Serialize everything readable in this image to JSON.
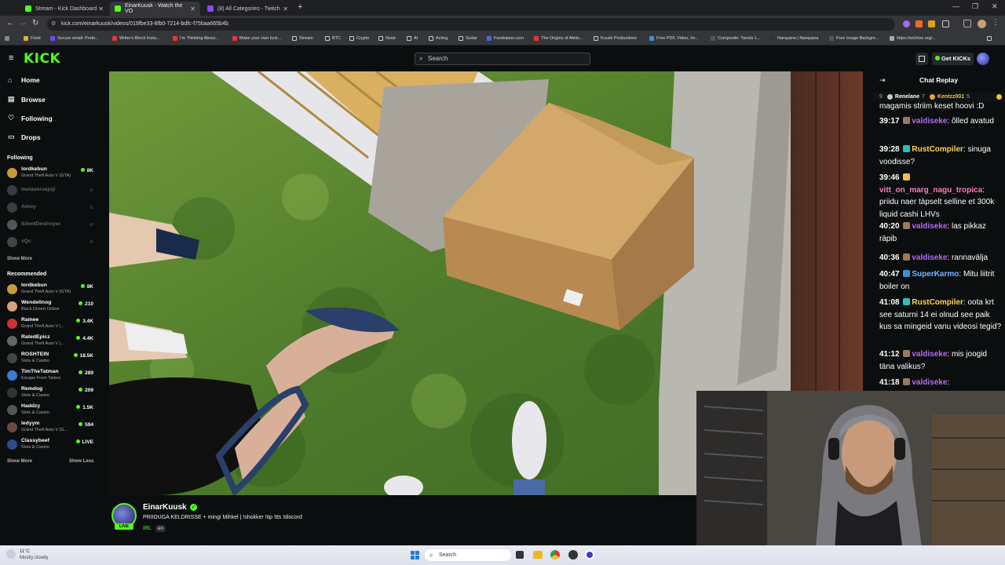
{
  "browser": {
    "tabs": [
      {
        "label": "Stream - Kick Dashboard",
        "color": "#53fc18",
        "active": false
      },
      {
        "label": "EinarKuusk - Watch the VO",
        "color": "#53fc18",
        "active": true
      },
      {
        "label": "(8) All Categories - Twitch",
        "color": "#9146ff",
        "active": false
      }
    ],
    "url": "kick.com/einarkuusk/videos/019fbe33-8fb0-7214-bdfc-f75baa665b4b",
    "bookmarks": [
      "Food",
      "Secure email: Proto...",
      "Writer's Block Insta...",
      "I'm Thinking About...",
      "Make your own luck...",
      "Stream",
      "BTC",
      "Crypto",
      "Nostr",
      "AI",
      "Acting",
      "Guitar",
      "Fundraiser.com",
      "The Origins of Akkis...",
      "Kuusk Productions",
      "Free PDF, Video, Im...",
      "Composite: Tavola 1...",
      "Narayana | Narayana",
      "Free Image Backgro...",
      "https://archive.org/..."
    ]
  },
  "header": {
    "logo": "KICK",
    "search_placeholder": "Search",
    "get_kicks": "Get KICKs"
  },
  "nav": {
    "home": "Home",
    "browse": "Browse",
    "following": "Following",
    "drops": "Drops"
  },
  "following": {
    "title": "Following",
    "channels": [
      {
        "name": "lordkebun",
        "game": "Grand Theft Auto V (GTA)",
        "viewers": "8K",
        "live": true,
        "color": "#c89a3a"
      },
      {
        "name": "metaversejoji",
        "live": false,
        "color": "#7a6a8a"
      },
      {
        "name": "Amoy",
        "live": false,
        "color": "#777"
      },
      {
        "name": "SilentDestroyer",
        "live": false,
        "color": "#aaa"
      },
      {
        "name": "xQc",
        "live": false,
        "color": "#888"
      }
    ],
    "show_more": "Show More"
  },
  "recommended": {
    "title": "Recommended",
    "channels": [
      {
        "name": "lordkebun",
        "game": "Grand Theft Auto V (GTA)",
        "viewers": "8K",
        "color": "#c89a3a"
      },
      {
        "name": "Wendellnog",
        "game": "Black Desert Online",
        "viewers": "210",
        "color": "#d4a27a"
      },
      {
        "name": "Ramee",
        "game": "Grand Theft Auto V (...",
        "viewers": "3.4K",
        "color": "#c33"
      },
      {
        "name": "RatedEpicz",
        "game": "Grand Theft Auto V (...",
        "viewers": "4.4K",
        "color": "#666"
      },
      {
        "name": "ROSHTEIN",
        "game": "Slots & Casino",
        "viewers": "18.5K",
        "color": "#444"
      },
      {
        "name": "TimTheTatman",
        "game": "Escape From Tarkov",
        "viewers": "289",
        "color": "#3a7bd5"
      },
      {
        "name": "Remdog",
        "game": "Slots & Casino",
        "viewers": "209",
        "color": "#333"
      },
      {
        "name": "Haddzy",
        "game": "Slots & Casino",
        "viewers": "1.5K",
        "color": "#555"
      },
      {
        "name": "ledyym",
        "game": "Grand Theft Auto V (G...",
        "viewers": "594",
        "color": "#6a4a3a"
      },
      {
        "name": "Classybeef",
        "game": "Slots & Casino",
        "viewers": "LIVE",
        "color": "#2a4d8a"
      }
    ],
    "show_more": "Show More",
    "show_less": "Show Less"
  },
  "chat": {
    "title": "Chat Replay",
    "top_row": {
      "pos": "9",
      "user1": "Renelane",
      "count1": "7",
      "user2": "Kentzz001",
      "count2": "5"
    },
    "first_line": "magamis striim keset hoovi :D",
    "messages": [
      {
        "time": "39:17",
        "user": "valdiseke",
        "color": "#b46cf0",
        "text": "õlled avatud"
      },
      {
        "time": "39:28",
        "user": "RustCompiler",
        "color": "#ffd34d",
        "text": "sinuga voodisse?"
      },
      {
        "time": "39:46",
        "user": "vitt_on_marg_nagu_tropica",
        "color": "#ff7ab8",
        "text": "priidu naer tàpselt selline et 300k liquid cashi LHVs"
      },
      {
        "time": "40:20",
        "user": "valdiseke",
        "color": "#b46cf0",
        "text": "las pikkaz räpib"
      },
      {
        "time": "40:36",
        "user": "valdiseke",
        "color": "#b46cf0",
        "text": "rannavälja"
      },
      {
        "time": "40:47",
        "user": "SuperKarmo",
        "color": "#74b6ff",
        "text": "Mitu liitrit boiler on"
      },
      {
        "time": "41:08",
        "user": "RustCompiler",
        "color": "#ffd34d",
        "text": "oota krt see saturni 14 ei olnud see paik kus sa mingeid vanu videosi tegid?"
      },
      {
        "time": "41:12",
        "user": "valdiseke",
        "color": "#b46cf0",
        "text": "mis joogid täna valikus?"
      },
      {
        "time": "41:18",
        "user": "valdiseke",
        "color": "#b46cf0",
        "text": ""
      }
    ]
  },
  "stream": {
    "channel": "EinarKuusk",
    "title": "PRIIDUGA KELDRISSE + mingi Mihkel | !shokker !tip !tts !discord",
    "category": "IRL",
    "language": "en",
    "live_badge": "LIVE"
  },
  "taskbar": {
    "temp": "11°C",
    "weather": "Mostly cloudy",
    "search": "Search"
  }
}
